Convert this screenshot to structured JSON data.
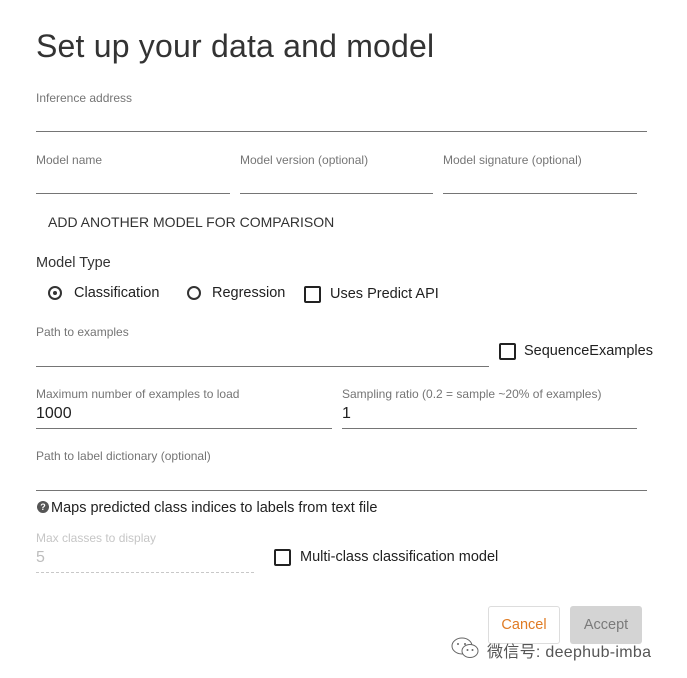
{
  "dialog": {
    "title": "Set up your data and model",
    "inference_address": {
      "label": "Inference address",
      "value": ""
    },
    "model_name": {
      "label": "Model name",
      "value": ""
    },
    "model_version": {
      "label": "Model version (optional)",
      "value": ""
    },
    "model_signature": {
      "label": "Model signature (optional)",
      "value": ""
    },
    "add_model_button": "ADD ANOTHER MODEL FOR COMPARISON",
    "model_type": {
      "label": "Model Type",
      "options": [
        {
          "label": "Classification",
          "selected": true
        },
        {
          "label": "Regression",
          "selected": false
        }
      ],
      "uses_predict_api": {
        "label": "Uses Predict API",
        "checked": false
      }
    },
    "path_to_examples": {
      "label": "Path to examples",
      "value": ""
    },
    "sequence_examples": {
      "label": "SequenceExamples",
      "checked": false
    },
    "max_examples": {
      "label": "Maximum number of examples to load",
      "value": "1000"
    },
    "sampling_ratio": {
      "label": "Sampling ratio (0.2 = sample ~20% of examples)",
      "value": "1"
    },
    "label_dictionary": {
      "label": "Path to label dictionary (optional)",
      "value": ""
    },
    "help_text": "Maps predicted class indices to labels from text file",
    "max_classes": {
      "label": "Max classes to display",
      "value": "5",
      "disabled": true
    },
    "multi_class": {
      "label": "Multi-class classification model",
      "checked": false
    },
    "cancel_button": "Cancel",
    "accept_button": "Accept"
  },
  "watermark": {
    "text": "微信号: deephub-imba",
    "icon": "wechat-icon"
  }
}
